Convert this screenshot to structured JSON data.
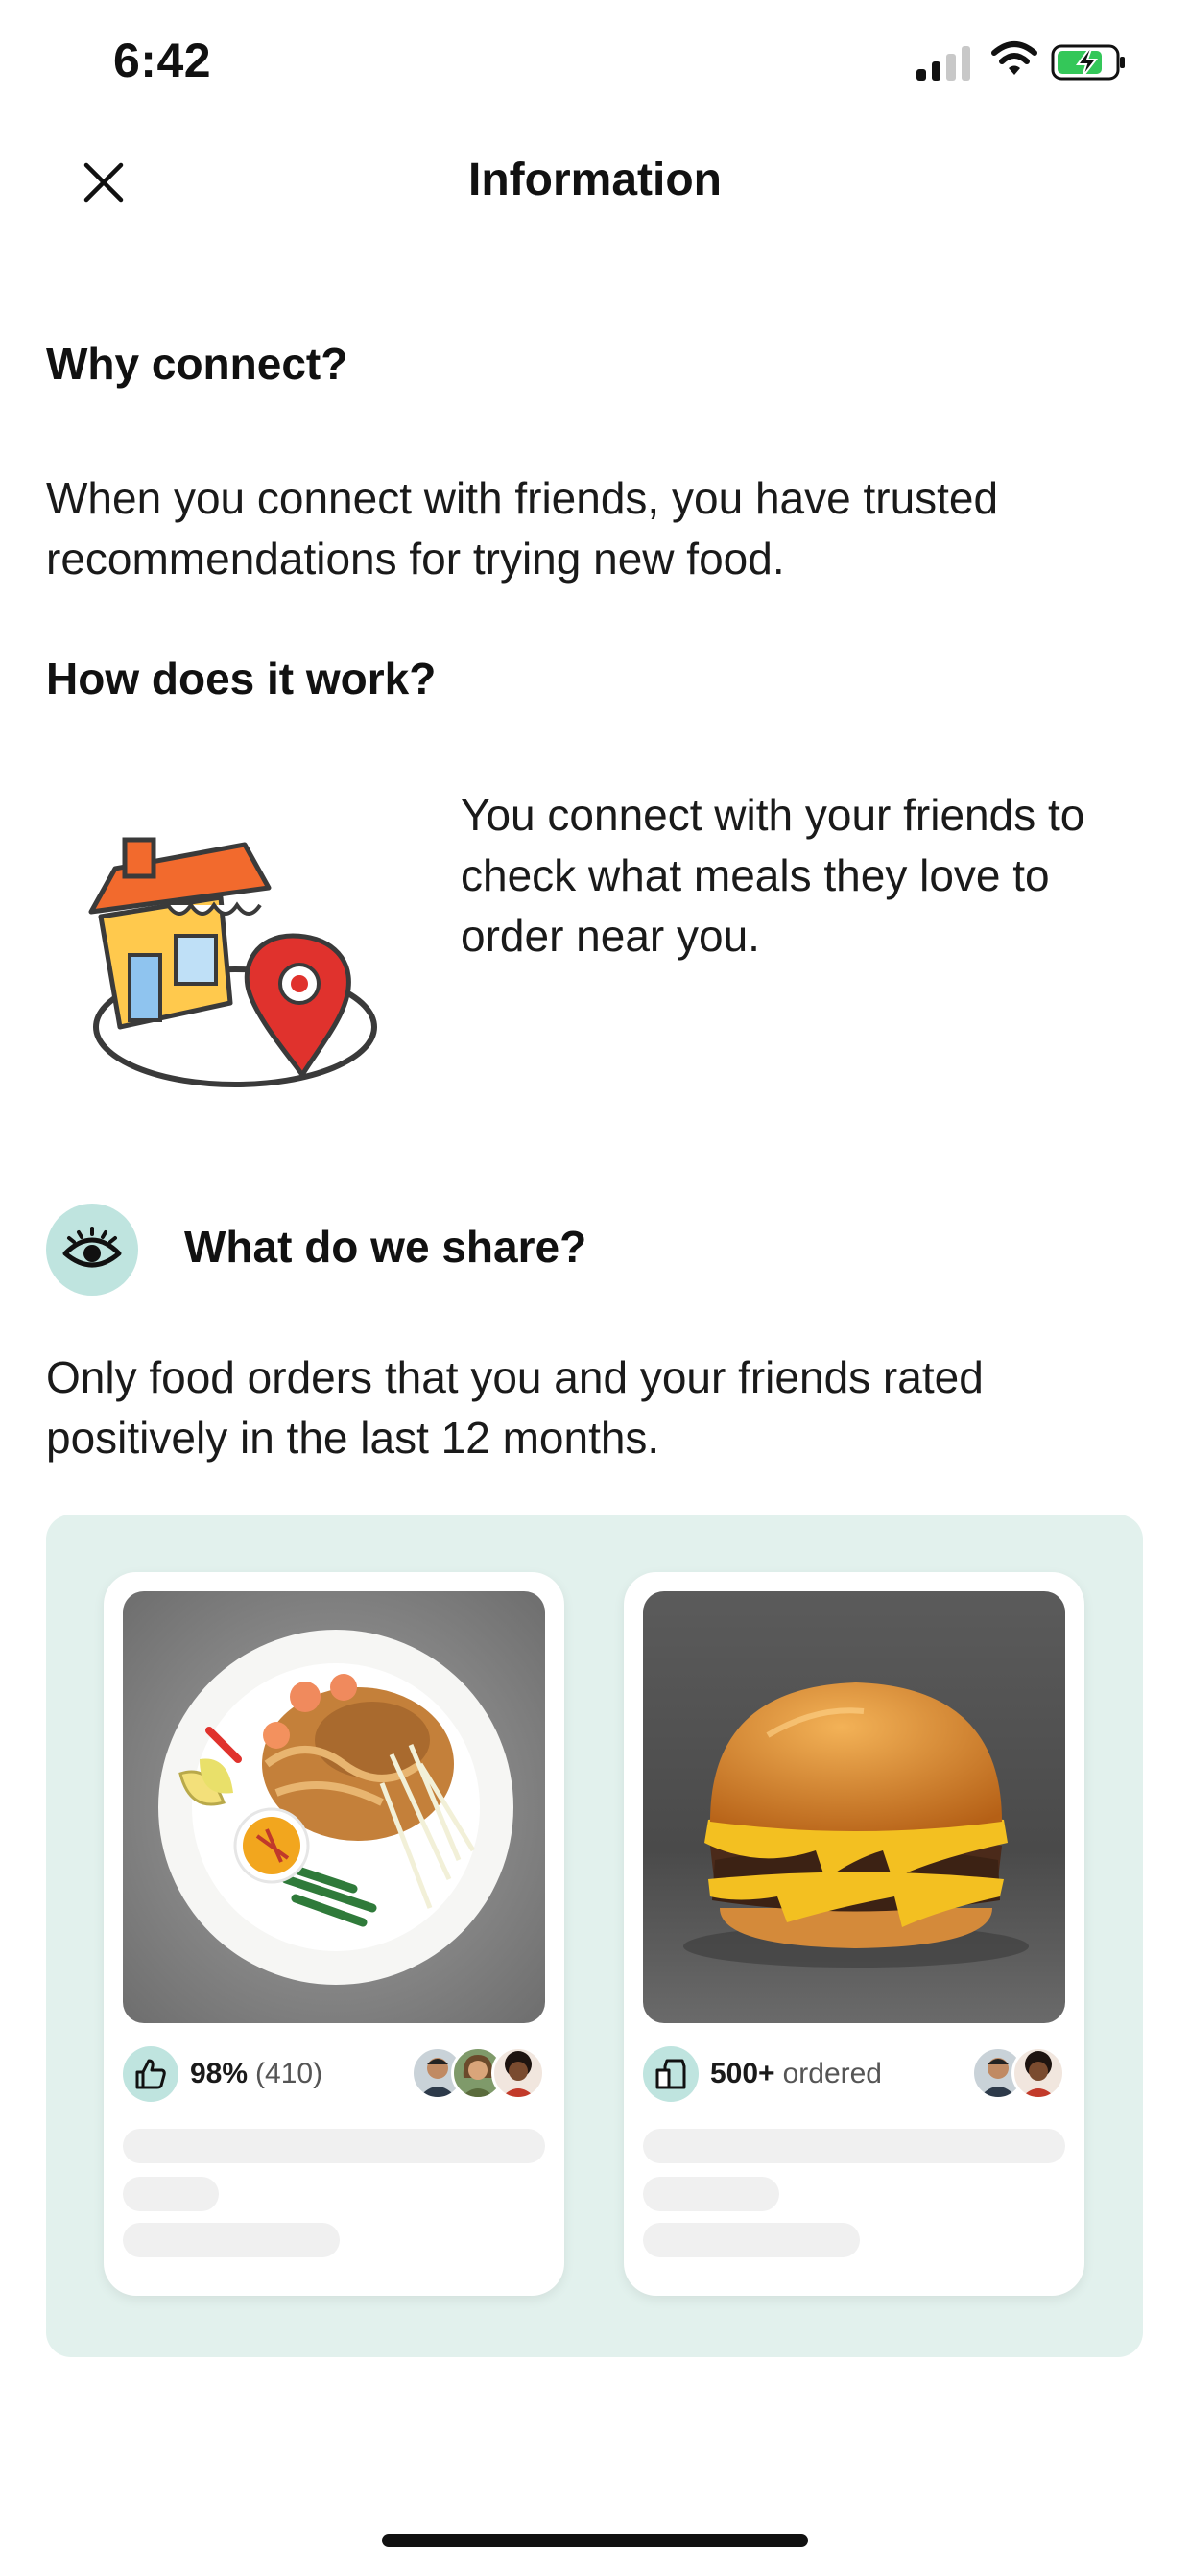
{
  "status_bar": {
    "time": "6:42"
  },
  "header": {
    "title": "Information"
  },
  "sections": {
    "why": {
      "title": "Why connect?",
      "body": "When you connect with friends, you have trusted recommendations for trying new food."
    },
    "how": {
      "title": "How does it work?",
      "body": "You connect with your friends to check what meals they love to order near you."
    },
    "share": {
      "title": "What do we share?",
      "body": "Only food orders that you and your friends rated positively in the last 12 months."
    }
  },
  "cards": [
    {
      "stat": "98%",
      "count": "(410)",
      "icon": "thumbs-up-icon",
      "avatars": 3
    },
    {
      "stat": "500+",
      "count": "ordered",
      "icon": "shopping-bag-icon",
      "avatars": 2
    }
  ],
  "colors": {
    "accent_mint": "#bfe4df",
    "showcase_bg": "#e2f1ed",
    "battery_green": "#34c759"
  }
}
